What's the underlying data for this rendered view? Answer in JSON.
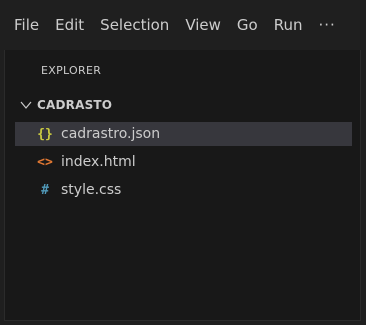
{
  "menubar": {
    "items": [
      "File",
      "Edit",
      "Selection",
      "View",
      "Go",
      "Run"
    ],
    "more": "···"
  },
  "explorer": {
    "title": "EXPLORER",
    "folder": {
      "name": "CADRASTO",
      "expanded": true
    },
    "files": [
      {
        "name": "cadrastro.json",
        "icon": "{}",
        "icon_name": "json-icon",
        "icon_color": "#cbcb41",
        "selected": true
      },
      {
        "name": "index.html",
        "icon": "<>",
        "icon_name": "html-icon",
        "icon_color": "#e37933",
        "selected": false
      },
      {
        "name": "style.css",
        "icon": "#",
        "icon_name": "css-icon",
        "icon_color": "#519aba",
        "selected": false
      }
    ]
  }
}
